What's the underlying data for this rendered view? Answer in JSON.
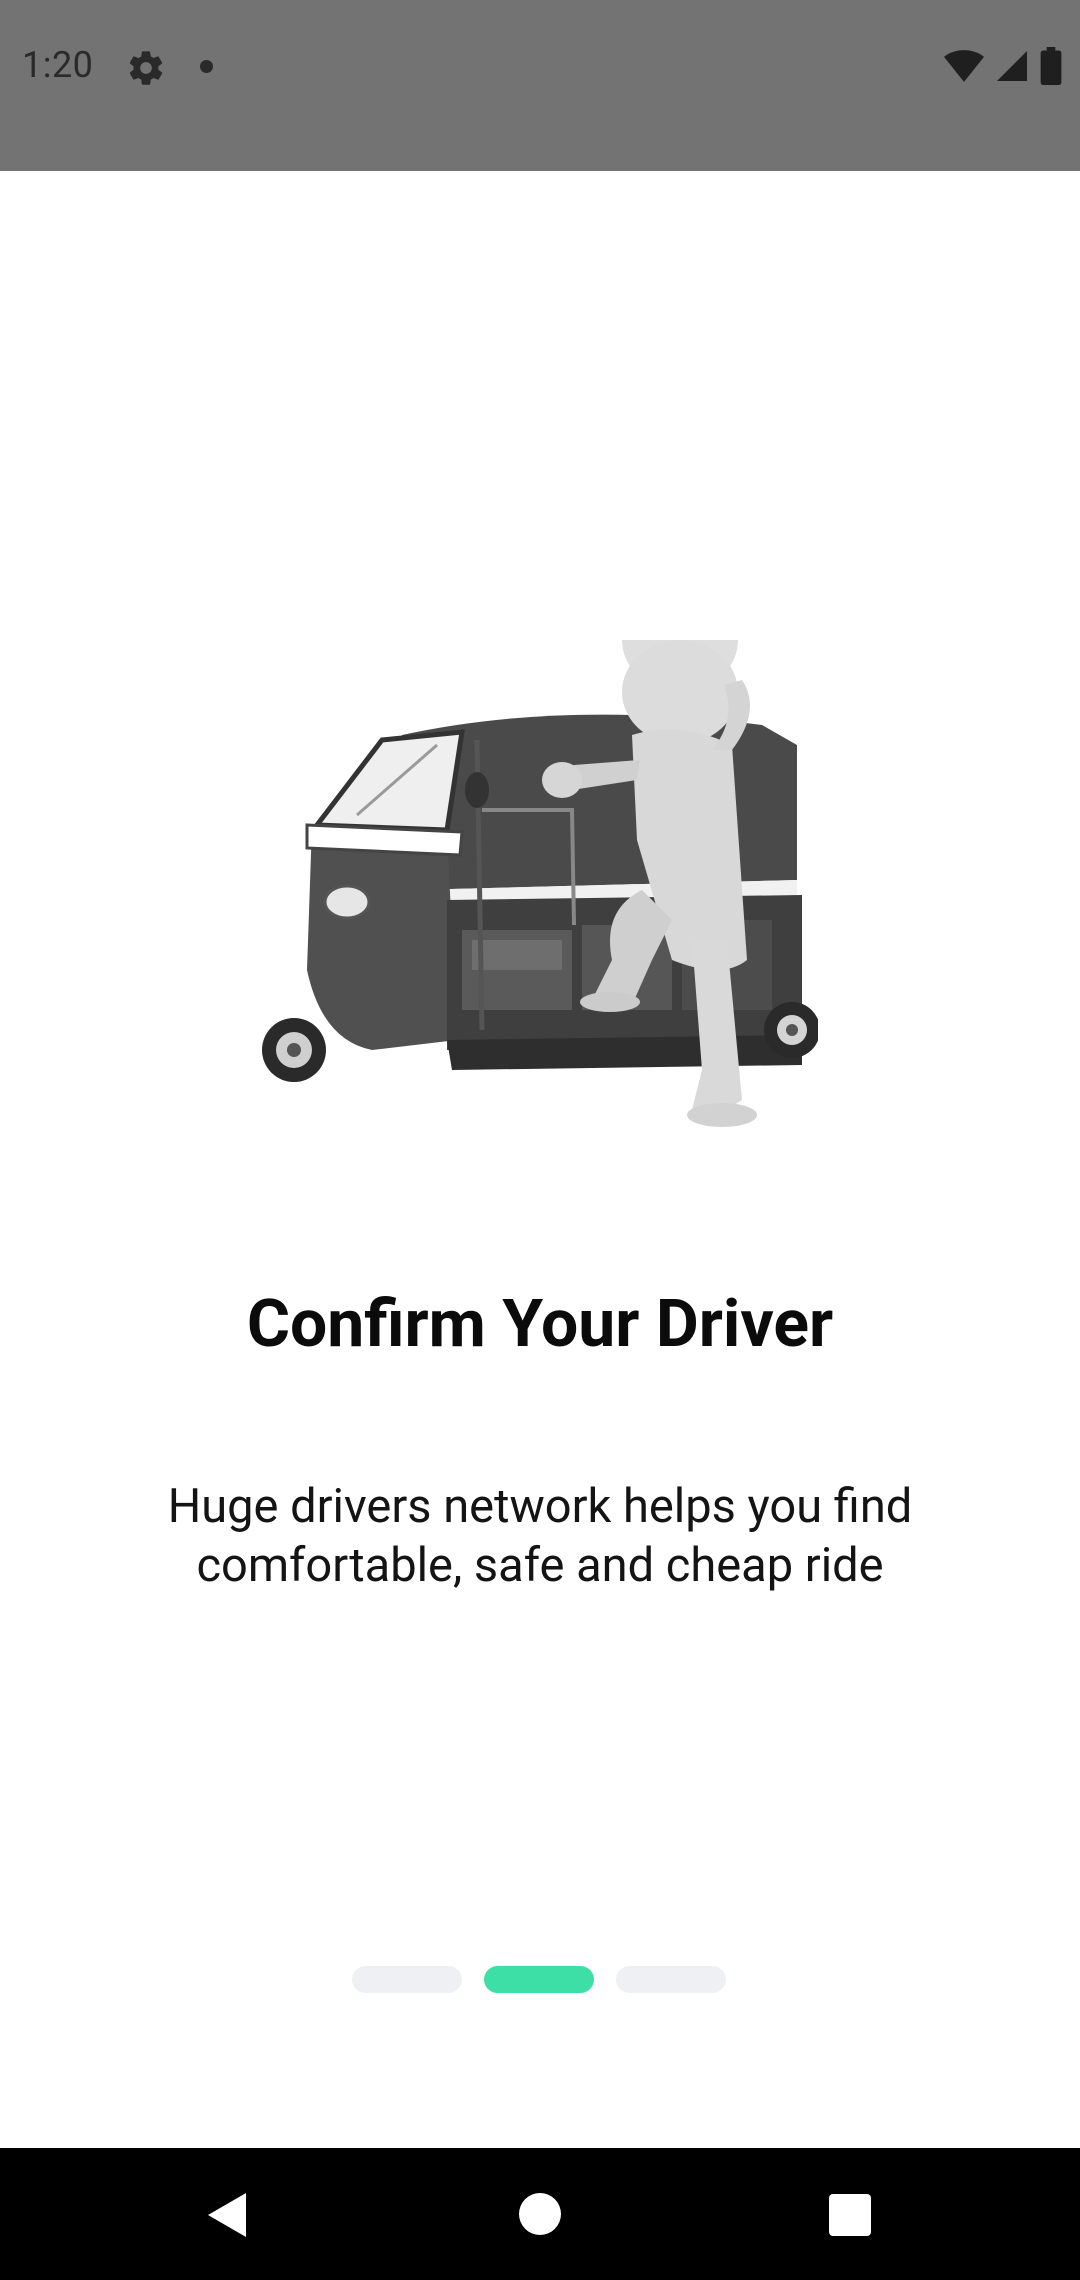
{
  "status_bar": {
    "time": "1:20",
    "icons": [
      "gear-icon",
      "notification-dot-icon",
      "wifi-icon",
      "cell-signal-icon",
      "battery-icon"
    ]
  },
  "onboarding": {
    "illustration": "auto-rickshaw-with-person-illustration",
    "title": "Confirm Your Driver",
    "description": "Huge drivers network helps you find comfortable, safe and cheap ride"
  },
  "pager": {
    "total": 3,
    "active_index": 1,
    "active_color": "#3ddfa6",
    "inactive_color": "#eef0f4"
  },
  "nav_bar": {
    "icons": [
      "back-icon",
      "home-icon",
      "recents-icon"
    ]
  }
}
